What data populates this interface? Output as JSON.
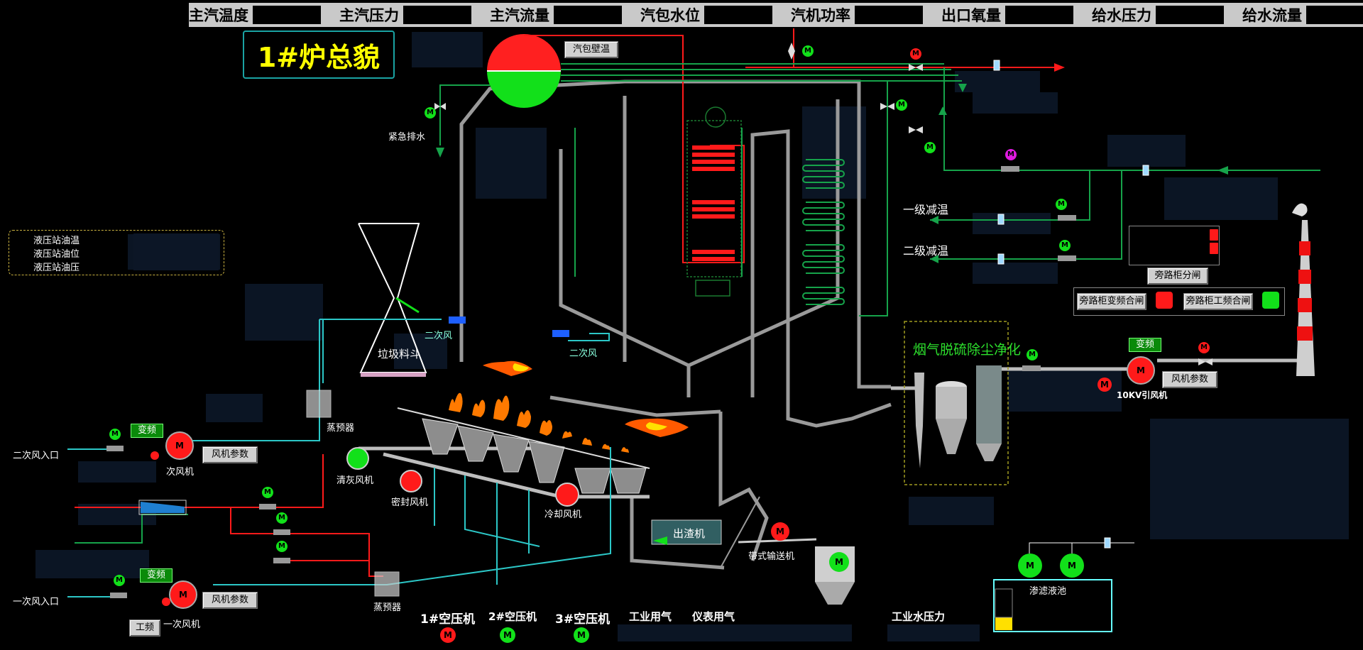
{
  "header": {
    "items": [
      {
        "label": "主汽温度"
      },
      {
        "label": "主汽压力"
      },
      {
        "label": "主汽流量"
      },
      {
        "label": "汽包水位"
      },
      {
        "label": "汽机功率"
      },
      {
        "label": "出口氧量"
      },
      {
        "label": "给水压力"
      },
      {
        "label": "给水流量"
      }
    ]
  },
  "title": "1#炉总貌",
  "buttons": {
    "drum_wall_temp": "汽包壁温",
    "fan_params_secondary": "风机参数",
    "fan_params_primary": "风机参数",
    "fan_params_induced": "风机参数",
    "bypass_split": "旁路柜分闸",
    "bypass_vfd_close": "旁路柜变频合闸",
    "bypass_power_close": "旁路柜工频合闸",
    "power_freq": "工频"
  },
  "badges": {
    "vfd_secondary": "变频",
    "vfd_primary": "变频",
    "vfd_induced": "变频"
  },
  "labels": {
    "emergency_drain": "紧急排水",
    "desuper_1": "一级减温",
    "desuper_2": "二级减温",
    "secondary_air_a": "二次风",
    "secondary_air_b": "二次风",
    "waste_hopper": "垃圾料斗",
    "steam_preheater_a": "蒸预器",
    "steam_preheater_b": "蒸预器",
    "flue_gas_cleaning": "烟气脱硫除尘净化",
    "induced_fan": "10KV引风机",
    "secondary_fan": "次风机",
    "primary_fan": "一次风机",
    "secondary_air_inlet": "二次风入口",
    "primary_air_inlet": "一次风入口",
    "ash_fan": "清灰风机",
    "seal_fan": "密封风机",
    "cooling_fan": "冷却风机",
    "slag_remover": "出渣机",
    "belt_conveyor": "带式输送机",
    "leachate_pool": "渗滤液池",
    "bypass_text": "旁路"
  },
  "hydraulic": {
    "items": [
      "液压站油温",
      "液压站油位",
      "液压站油压"
    ]
  },
  "bottom": {
    "compressors": [
      {
        "label": "1#空压机",
        "status": "red"
      },
      {
        "label": "2#空压机",
        "status": "green"
      },
      {
        "label": "3#空压机",
        "status": "green"
      }
    ],
    "industrial_air": "工业用气",
    "instrument_air": "仪表用气",
    "industrial_water": "工业水压力"
  },
  "motor_letter": "M",
  "colors": {
    "pipe_gray": "#9a9a9a",
    "steam_red": "#ff1a1a",
    "water_green": "#16a34a",
    "air_cyan": "#3ad0d0",
    "header_bg": "#c9c9c9",
    "title_yellow": "#ffff00"
  }
}
